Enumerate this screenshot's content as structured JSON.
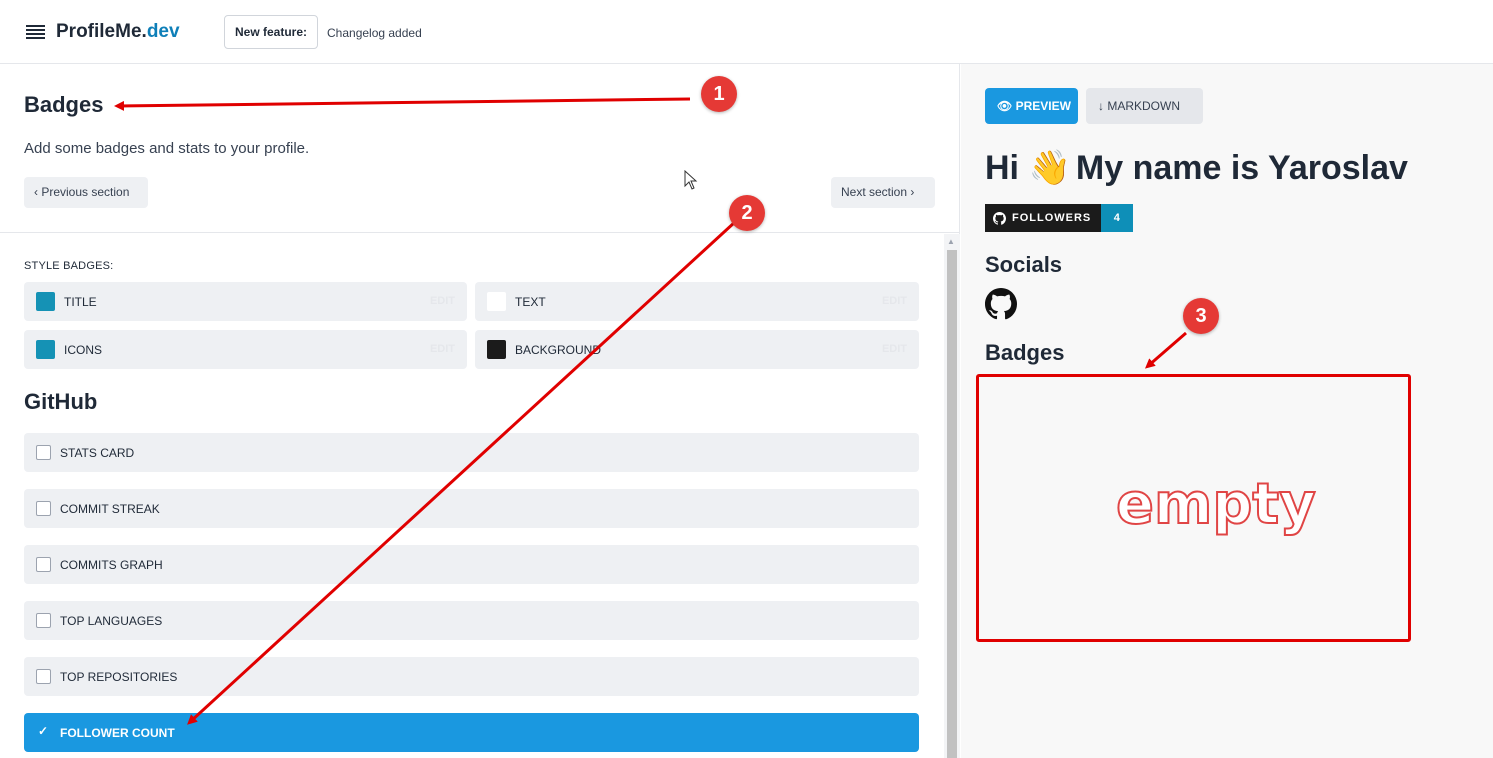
{
  "header": {
    "logo_main": "ProfileMe.",
    "logo_accent": "dev",
    "feature_label": "New feature:",
    "feature_text": "Changelog added"
  },
  "editor": {
    "title": "Badges",
    "description": "Add some badges and stats to your profile.",
    "prev_label": "Previous section",
    "next_label": "Next section",
    "style_heading": "STYLE BADGES:",
    "style_items": [
      {
        "label": "TITLE",
        "color": "#1592b5",
        "edit": "EDIT"
      },
      {
        "label": "TEXT",
        "color": "#ffffff",
        "edit": "EDIT"
      },
      {
        "label": "ICONS",
        "color": "#1592b5",
        "edit": "EDIT"
      },
      {
        "label": "BACKGROUND",
        "color": "#1b1b1b",
        "edit": "EDIT"
      }
    ],
    "github_heading": "GitHub",
    "github_items": [
      {
        "label": "STATS CARD",
        "checked": false
      },
      {
        "label": "COMMIT STREAK",
        "checked": false
      },
      {
        "label": "COMMITS GRAPH",
        "checked": false
      },
      {
        "label": "TOP LANGUAGES",
        "checked": false
      },
      {
        "label": "TOP REPOSITORIES",
        "checked": false
      },
      {
        "label": "FOLLOWER COUNT",
        "checked": true
      }
    ]
  },
  "preview": {
    "preview_label": "PREVIEW",
    "markdown_label": "MARKDOWN",
    "greeting_before": "Hi",
    "greeting_emoji": "👋",
    "greeting_after": "My name is Yaroslav",
    "badge_label": "FOLLOWERS",
    "badge_count": "4",
    "socials_title": "Socials",
    "badges_title": "Badges"
  },
  "annotations": {
    "markers": [
      "1",
      "2",
      "3"
    ],
    "empty_text": "empty",
    "color": "#e00000"
  }
}
